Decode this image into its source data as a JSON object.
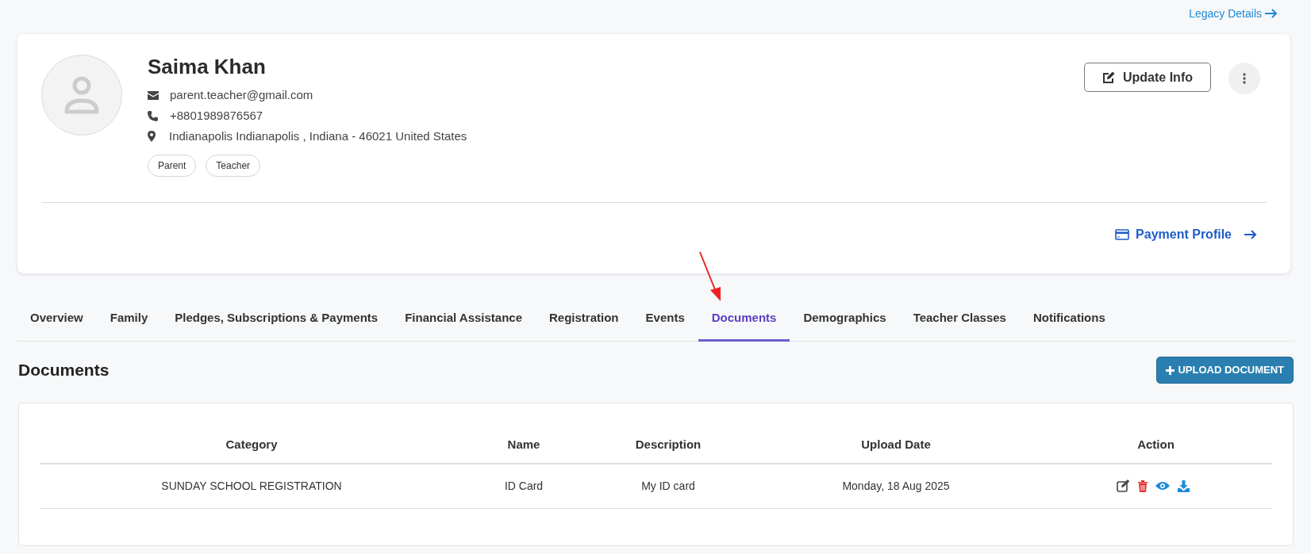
{
  "legacy_link": "Legacy Details",
  "profile": {
    "name": "Saima Khan",
    "email": "parent.teacher@gmail.com",
    "phone": "+8801989876567",
    "address": "Indianapolis Indianapolis , Indiana - 46021 United States",
    "roles": [
      "Parent",
      "Teacher"
    ],
    "update_button": "Update Info",
    "payment_link": "Payment Profile"
  },
  "tabs": [
    {
      "label": "Overview",
      "selected": false
    },
    {
      "label": "Family",
      "selected": false
    },
    {
      "label": "Pledges, Subscriptions & Payments",
      "selected": false
    },
    {
      "label": "Financial Assistance",
      "selected": false
    },
    {
      "label": "Registration",
      "selected": false
    },
    {
      "label": "Events",
      "selected": false
    },
    {
      "label": "Documents",
      "selected": true
    },
    {
      "label": "Demographics",
      "selected": false
    },
    {
      "label": "Teacher Classes",
      "selected": false
    },
    {
      "label": "Notifications",
      "selected": false
    }
  ],
  "section": {
    "title": "Documents",
    "upload_button": "UPLOAD DOCUMENT"
  },
  "table": {
    "columns": [
      "Category",
      "Name",
      "Description",
      "Upload Date",
      "Action"
    ],
    "rows": [
      {
        "category": "SUNDAY SCHOOL REGISTRATION",
        "name": "ID Card",
        "description": "My ID card",
        "upload_date": "Monday, 18 Aug 2025"
      }
    ]
  }
}
